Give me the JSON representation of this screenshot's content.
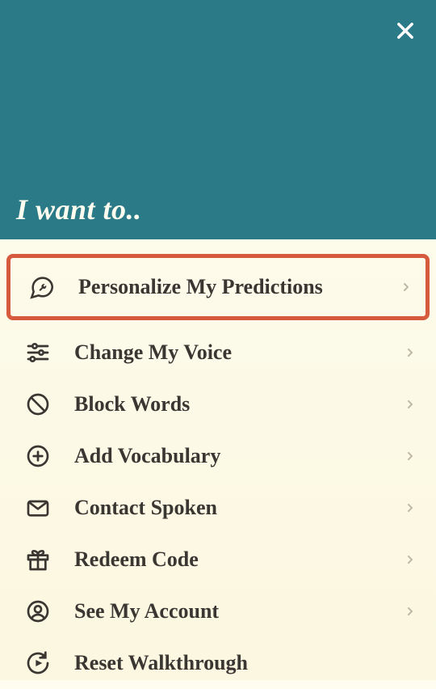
{
  "header": {
    "title": "I want to.."
  },
  "items": [
    {
      "label": "Personalize My Predictions",
      "icon": "wrench-chat-icon",
      "highlighted": true,
      "chevron": true
    },
    {
      "label": "Change My Voice",
      "icon": "sliders-icon",
      "highlighted": false,
      "chevron": true
    },
    {
      "label": "Block Words",
      "icon": "block-icon",
      "highlighted": false,
      "chevron": true
    },
    {
      "label": "Add Vocabulary",
      "icon": "plus-circle-icon",
      "highlighted": false,
      "chevron": true
    },
    {
      "label": "Contact Spoken",
      "icon": "mail-icon",
      "highlighted": false,
      "chevron": true
    },
    {
      "label": "Redeem Code",
      "icon": "gift-icon",
      "highlighted": false,
      "chevron": true
    },
    {
      "label": "See My Account",
      "icon": "account-icon",
      "highlighted": false,
      "chevron": true
    },
    {
      "label": "Reset Walkthrough",
      "icon": "replay-icon",
      "highlighted": false,
      "chevron": false
    }
  ]
}
